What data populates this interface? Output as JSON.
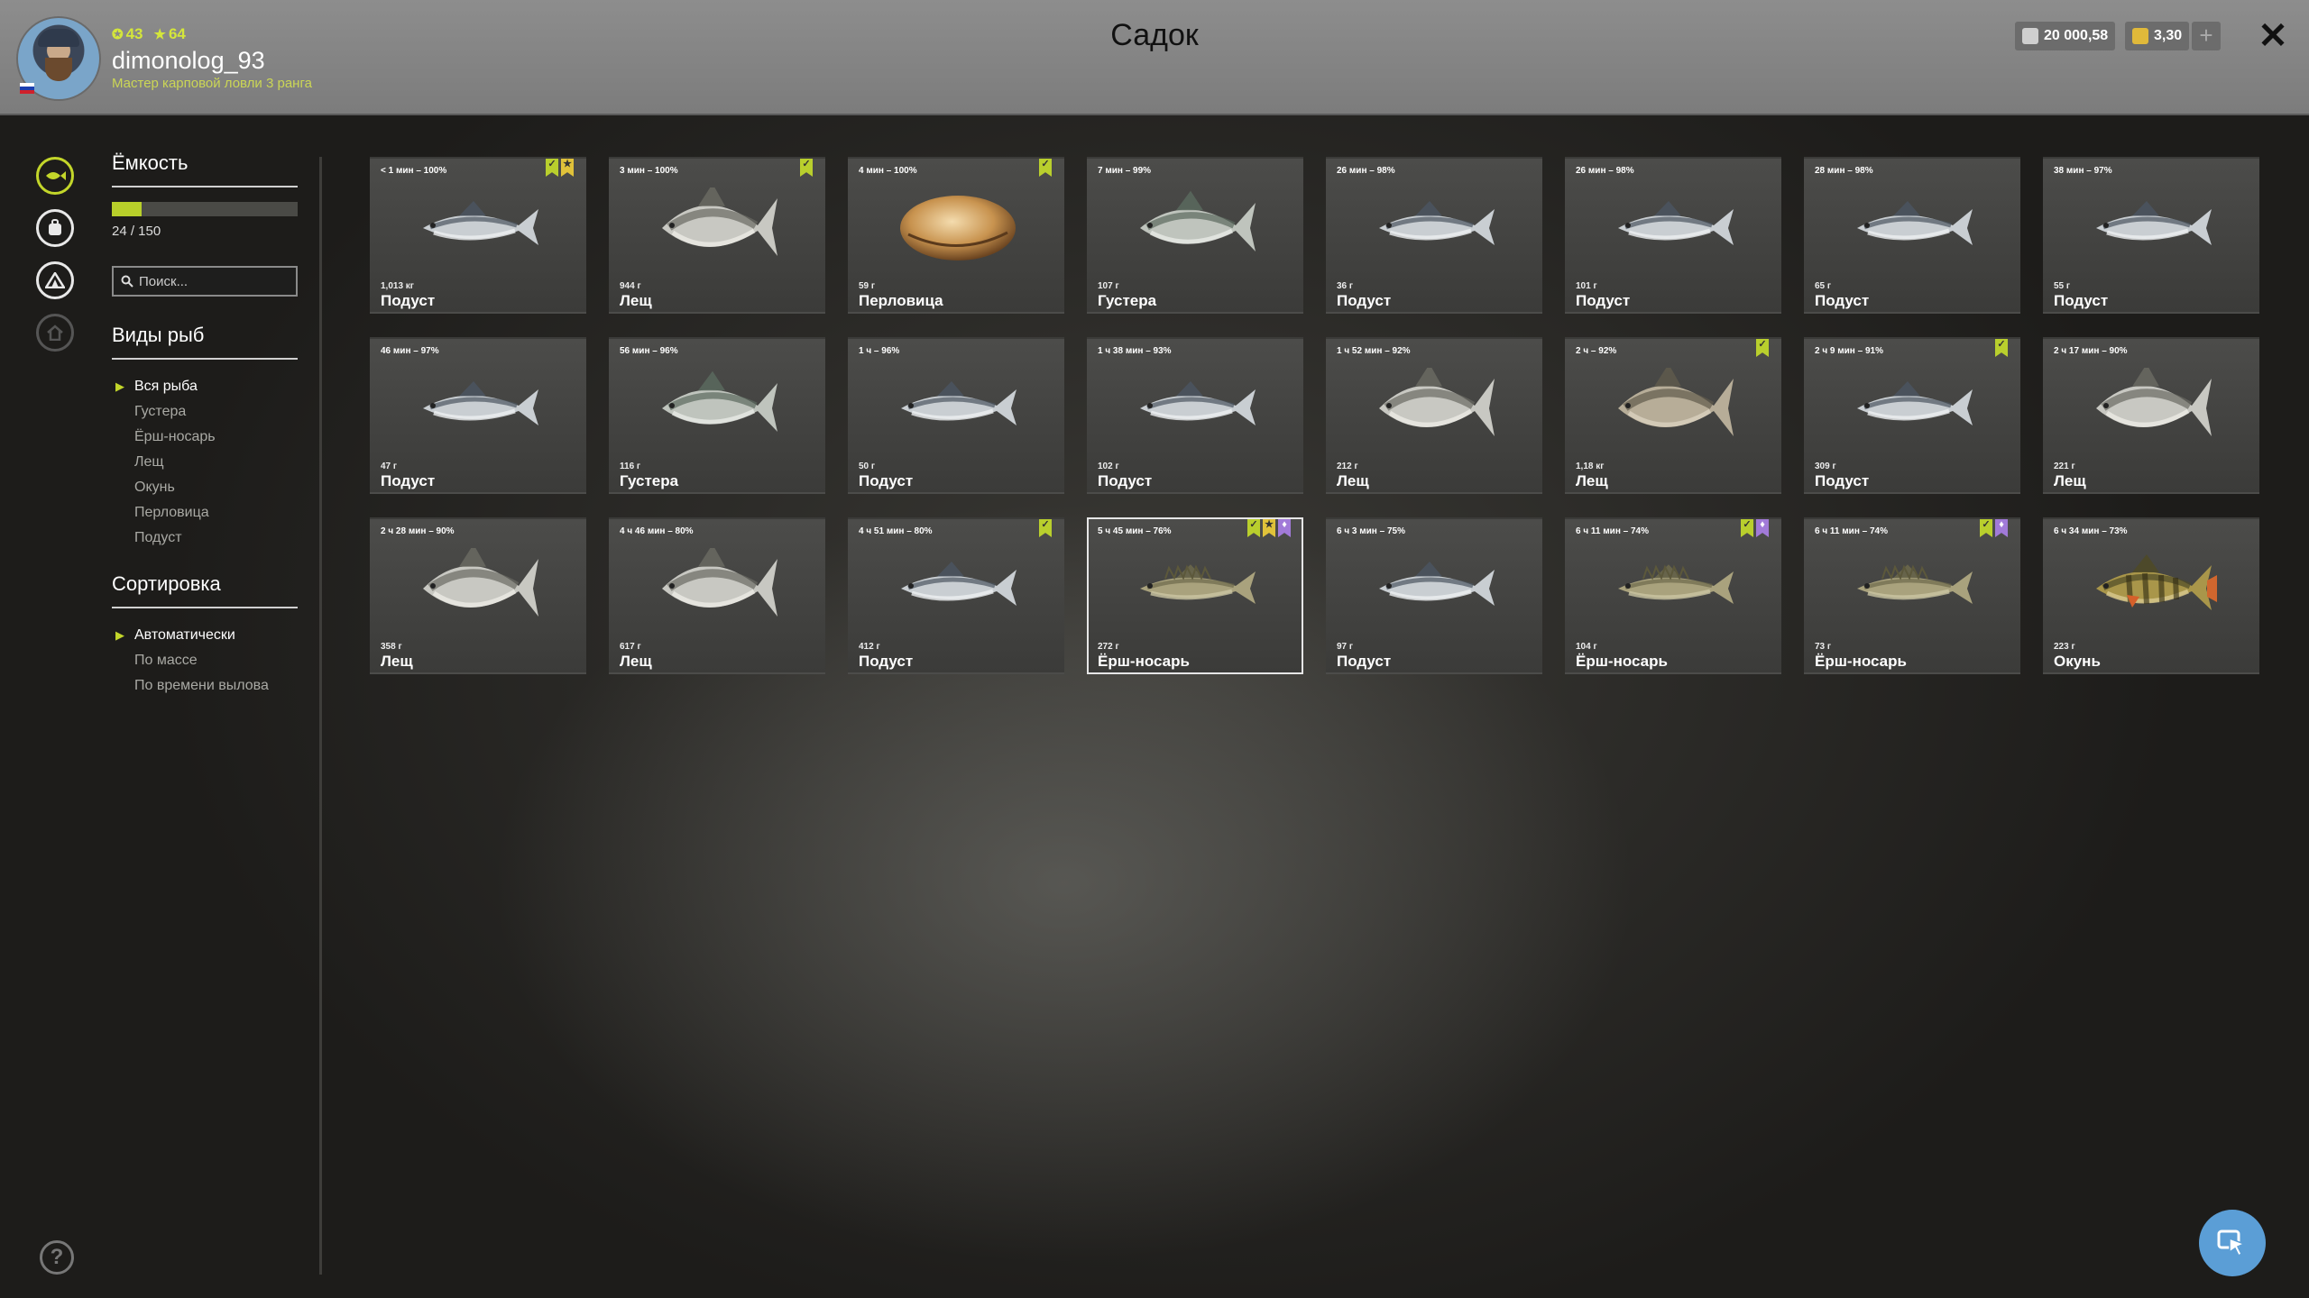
{
  "header": {
    "title": "Садок",
    "player": {
      "level": "43",
      "stars": "64",
      "name": "dimonolog_93",
      "rank": "Мастер карповой ловли 3 ранга"
    },
    "silver": "20 000,58",
    "gold": "3,30",
    "add_icon": "plus-icon",
    "close_icon": "close-icon",
    "colors": {
      "accent": "#c3d62a",
      "silver_icon": "#cfcfcf",
      "gold_icon": "#e0b93a"
    }
  },
  "sidebar_icons": [
    "fish-icon",
    "backpack-icon",
    "tent-icon",
    "home-icon"
  ],
  "capacity": {
    "title": "Ёмкость",
    "value": "24 / 150",
    "fraction": 0.16
  },
  "search": {
    "placeholder": "Поиск..."
  },
  "species": {
    "title": "Виды рыб",
    "items": [
      "Вся рыба",
      "Густера",
      "Ёрш-носарь",
      "Лещ",
      "Окунь",
      "Перловица",
      "Подуст"
    ],
    "selected": 0
  },
  "sorting": {
    "title": "Сортировка",
    "items": [
      "Автоматически",
      "По массе",
      "По времени вылова"
    ],
    "selected": 0
  },
  "fish": [
    {
      "time": "< 1 мин – 100%",
      "weight": "1,013 кг",
      "name": "Подуст",
      "kind": "podust",
      "badges": [
        "green",
        "yellow"
      ]
    },
    {
      "time": "3 мин – 100%",
      "weight": "944 г",
      "name": "Лещ",
      "kind": "bream",
      "badges": [
        "green"
      ]
    },
    {
      "time": "4 мин – 100%",
      "weight": "59 г",
      "name": "Перловица",
      "kind": "mussel",
      "badges": [
        "green"
      ]
    },
    {
      "time": "7 мин – 99%",
      "weight": "107 г",
      "name": "Густера",
      "kind": "gustera",
      "badges": []
    },
    {
      "time": "26 мин – 98%",
      "weight": "36 г",
      "name": "Подуст",
      "kind": "podust",
      "badges": []
    },
    {
      "time": "26 мин – 98%",
      "weight": "101 г",
      "name": "Подуст",
      "kind": "podust",
      "badges": []
    },
    {
      "time": "28 мин – 98%",
      "weight": "65 г",
      "name": "Подуст",
      "kind": "podust",
      "badges": []
    },
    {
      "time": "38 мин – 97%",
      "weight": "55 г",
      "name": "Подуст",
      "kind": "podust",
      "badges": []
    },
    {
      "time": "46 мин – 97%",
      "weight": "47 г",
      "name": "Подуст",
      "kind": "podust",
      "badges": []
    },
    {
      "time": "56 мин – 96%",
      "weight": "116 г",
      "name": "Густера",
      "kind": "gustera",
      "badges": []
    },
    {
      "time": "1 ч – 96%",
      "weight": "50 г",
      "name": "Подуст",
      "kind": "podust",
      "badges": []
    },
    {
      "time": "1 ч 38 мин – 93%",
      "weight": "102 г",
      "name": "Подуст",
      "kind": "podust",
      "badges": []
    },
    {
      "time": "1 ч 52 мин – 92%",
      "weight": "212 г",
      "name": "Лещ",
      "kind": "bream",
      "badges": []
    },
    {
      "time": "2 ч – 92%",
      "weight": "1,18 кг",
      "name": "Лещ",
      "kind": "bream2",
      "badges": [
        "green"
      ]
    },
    {
      "time": "2 ч 9 мин – 91%",
      "weight": "309 г",
      "name": "Подуст",
      "kind": "podust",
      "badges": [
        "green"
      ]
    },
    {
      "time": "2 ч 17 мин – 90%",
      "weight": "221 г",
      "name": "Лещ",
      "kind": "bream",
      "badges": []
    },
    {
      "time": "2 ч 28 мин – 90%",
      "weight": "358 г",
      "name": "Лещ",
      "kind": "bream",
      "badges": []
    },
    {
      "time": "4 ч 46 мин – 80%",
      "weight": "617 г",
      "name": "Лещ",
      "kind": "bream",
      "badges": []
    },
    {
      "time": "4 ч 51 мин – 80%",
      "weight": "412 г",
      "name": "Подуст",
      "kind": "podust",
      "badges": [
        "green"
      ]
    },
    {
      "time": "5 ч 45 мин – 76%",
      "weight": "272 г",
      "name": "Ёрш-носарь",
      "kind": "ruffe",
      "badges": [
        "green",
        "yellow",
        "purple"
      ],
      "selected": true
    },
    {
      "time": "6 ч 3 мин – 75%",
      "weight": "97 г",
      "name": "Подуст",
      "kind": "podust",
      "badges": []
    },
    {
      "time": "6 ч 11 мин – 74%",
      "weight": "104 г",
      "name": "Ёрш-носарь",
      "kind": "ruffe",
      "badges": [
        "green",
        "purple"
      ]
    },
    {
      "time": "6 ч 11 мин – 74%",
      "weight": "73 г",
      "name": "Ёрш-носарь",
      "kind": "ruffe",
      "badges": [
        "green",
        "purple"
      ]
    },
    {
      "time": "6 ч 34 мин – 73%",
      "weight": "223 г",
      "name": "Окунь",
      "kind": "perch",
      "badges": []
    }
  ],
  "help_icon": "help-icon",
  "fab_icon": "cursor-icon"
}
